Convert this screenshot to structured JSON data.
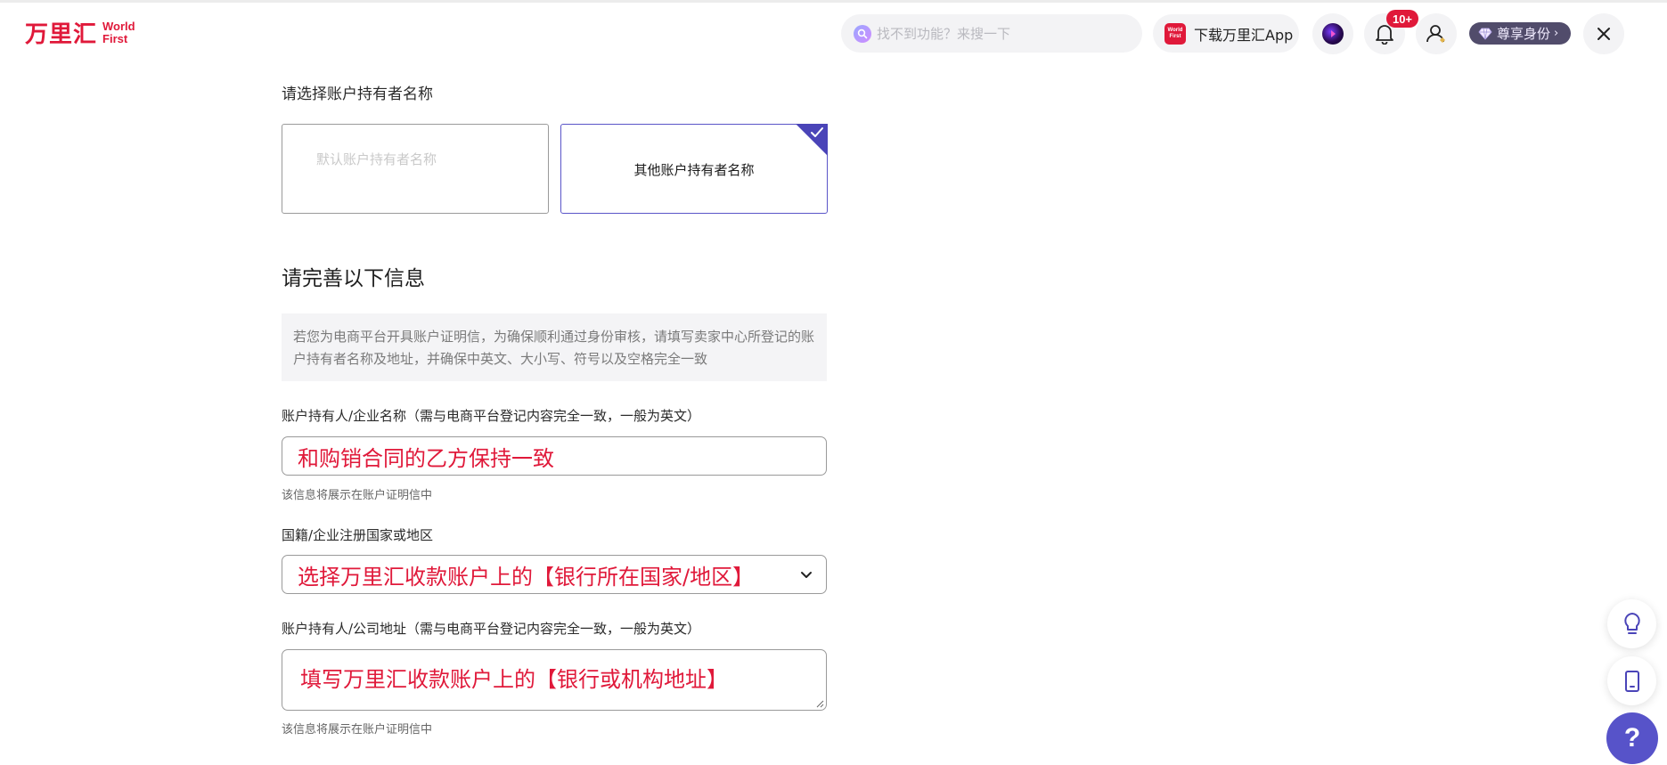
{
  "brand": {
    "logo_cn": "万里汇",
    "logo_en_line1": "World",
    "logo_en_line2": "First"
  },
  "header": {
    "search_placeholder": "找不到功能？来搜一下",
    "download_app_label": "下载万里汇App",
    "app_badge_line1": "World",
    "app_badge_line2": "First",
    "notification_count": "10+",
    "vip_label": "尊享身份",
    "vip_chevron": "›"
  },
  "account_holder": {
    "section_label": "请选择账户持有者名称",
    "options": [
      {
        "label": "默认账户持有者名称",
        "selected": false
      },
      {
        "label": "其他账户持有者名称",
        "selected": true
      }
    ]
  },
  "form": {
    "heading": "请完善以下信息",
    "notice": "若您为电商平台开具账户证明信，为确保顺利通过身份审核，请填写卖家中心所登记的账户持有者名称及地址，并确保中英文、大小写、符号以及空格完全一致",
    "name_field": {
      "label": "账户持有人/企业名称（需与电商平台登记内容完全一致，一般为英文）",
      "value": "和购销合同的乙方保持一致",
      "hint": "该信息将展示在账户证明信中"
    },
    "country_field": {
      "label": "国籍/企业注册国家或地区",
      "value": "选择万里汇收款账户上的【银行所在国家/地区】"
    },
    "address_field": {
      "label": "账户持有人/公司地址（需与电商平台登记内容完全一致，一般为英文）",
      "value": "填写万里汇收款账户上的【银行或机构地址】",
      "hint": "该信息将展示在账户证明信中"
    }
  },
  "floating": {
    "help_label": "?"
  },
  "colors": {
    "brand_red": "#e0193a",
    "accent_purple": "#4a44b8",
    "annotation_red": "#e0193a"
  }
}
